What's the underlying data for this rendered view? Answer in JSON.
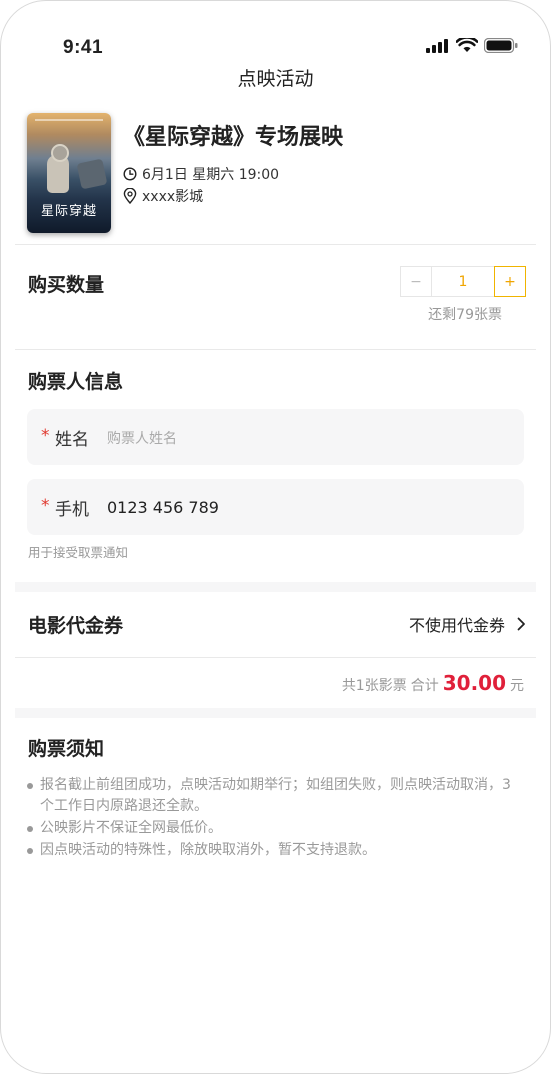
{
  "status_bar": {
    "time": "9:41"
  },
  "nav": {
    "title": "点映活动"
  },
  "event": {
    "poster_title": "星际穿越",
    "title": "《星际穿越》专场展映",
    "datetime": "6月1日 星期六 19:00",
    "venue": "xxxx影城"
  },
  "quantity": {
    "label": "购买数量",
    "minus": "−",
    "value": "1",
    "plus": "+",
    "remaining": "还剩79张票"
  },
  "buyer": {
    "section_title": "购票人信息",
    "required_mark": "*",
    "name_label": "姓名",
    "name_placeholder": "购票人姓名",
    "phone_label": "手机",
    "phone_value": "0123 456 789",
    "phone_hint": "用于接受取票通知"
  },
  "voucher": {
    "label": "电影代金券",
    "value": "不使用代金券"
  },
  "summary": {
    "count_text": "共1张影票",
    "total_label": "合计",
    "amount": "30.00",
    "currency": "元"
  },
  "notice": {
    "title": "购票须知",
    "items": [
      "报名截止前组团成功，点映活动如期举行；如组团失败，则点映活动取消，3个工作日内原路退还全款。",
      "公映影片不保证全网最低价。",
      "因点映活动的特殊性，除放映取消外，暂不支持退款。"
    ]
  },
  "colors": {
    "accent": "#f0a500",
    "price": "#e0203a",
    "required": "#e0392f"
  }
}
